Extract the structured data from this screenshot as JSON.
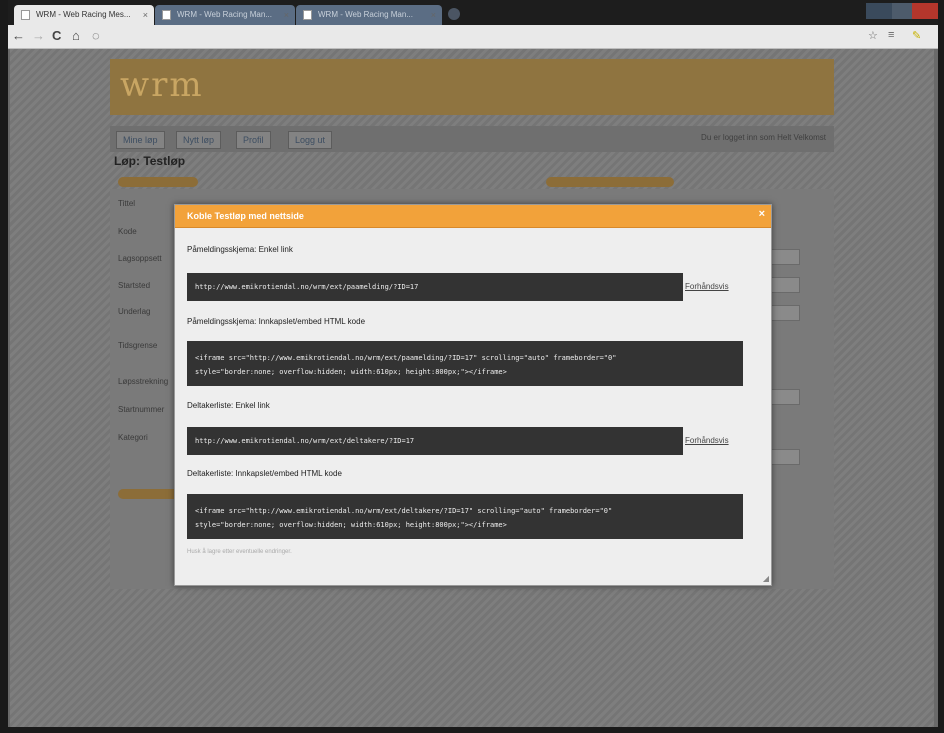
{
  "browser": {
    "tabs": [
      {
        "title": "WRM - Web Racing Mes...",
        "active": true
      },
      {
        "title": "WRM - Web Racing Man...",
        "active": false
      },
      {
        "title": "WRM - Web Racing Man...",
        "active": false
      }
    ],
    "tab_close": "×",
    "nav_icons": {
      "back": "←",
      "forward": "→",
      "reload": "C",
      "home": "⌂",
      "page": "◌"
    },
    "right_icons": {
      "star": "☆",
      "menu": "≡",
      "wrench": "✎"
    }
  },
  "site": {
    "logo_text": "wrm",
    "nav": [
      "Mine løp",
      "Nytt løp",
      "Profil",
      "Logg ut"
    ],
    "user_info": "Du er logget inn som Helt Velkomst",
    "page_title": "Løp: Testløp",
    "form_labels": [
      "Tittel",
      "Kode",
      "Lagsoppsett",
      "Startsted",
      "Underlag",
      "Tidsgrense",
      "Løpsstrekning",
      "Startnummer",
      "Kategori"
    ]
  },
  "modal": {
    "title": "Koble Testløp med nettsidе",
    "close": "×",
    "sections": [
      {
        "label": "Påmeldingsskjema: Enkel link",
        "code": "http://www.emikrotiendal.no/wrm/ext/paamelding/?ID=17",
        "verify": "Forhåndsvis"
      },
      {
        "label": "Påmeldingsskjema: Innkapslet/embed HTML kode",
        "code_lines": [
          "<iframe src=\"http://www.emikrotiendal.no/wrm/ext/paamelding/?ID=17\" scrolling=\"auto\" frameborder=\"0\"",
          "style=\"border:none; overflow:hidden; width:610px; height:800px;\"></iframe>"
        ]
      },
      {
        "label": "Deltakerliste: Enkel link",
        "code": "http://www.emikrotiendal.no/wrm/ext/deltakere/?ID=17",
        "verify": "Forhåndsvis"
      },
      {
        "label": "Deltakerliste: Innkapslet/embed HTML kode",
        "code_lines": [
          "<iframe src=\"http://www.emikrotiendal.no/wrm/ext/deltakere/?ID=17\" scrolling=\"auto\" frameborder=\"0\"",
          "style=\"border:none; overflow:hidden; width:610px; height:800px;\"></iframe>"
        ]
      }
    ],
    "footnote": "Husk å lagre etter eventuelle endringer."
  },
  "colors": {
    "accent": "#f2a23a",
    "code_bg": "#333333",
    "logo_band": "#8f7440"
  }
}
